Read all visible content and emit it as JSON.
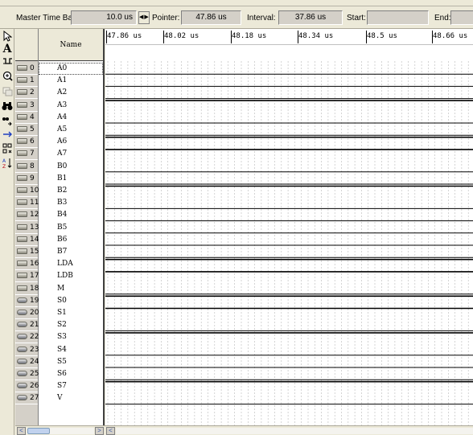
{
  "time_bar": {
    "master_label": "Master Time Bar:",
    "master_value": "10.0 us",
    "pointer_label": "Pointer:",
    "pointer_value": "47.86 us",
    "interval_label": "Interval:",
    "interval_value": "37.86 us",
    "start_label": "Start:",
    "start_value": "",
    "end_label": "End:",
    "end_value": ""
  },
  "toolbar": {
    "icons": [
      "selection-arrow-icon",
      "text-tool-icon",
      "waveform-editing-icon",
      "zoom-icon",
      "fullscreen-icon",
      "find-icon",
      "replace-icon",
      "assign-value-icon",
      "regroup-icon",
      "sort-icon"
    ]
  },
  "signal_table": {
    "name_header": "Name",
    "ruler_ticks": [
      "47.86 us",
      "48.02 us",
      "48.18 us",
      "48.34 us",
      "48.5 us",
      "48.66 us"
    ],
    "rows": [
      {
        "index": "0",
        "name": "A0",
        "kind": "input"
      },
      {
        "index": "1",
        "name": "A1",
        "kind": "input"
      },
      {
        "index": "2",
        "name": "A2",
        "kind": "input"
      },
      {
        "index": "3",
        "name": "A3",
        "kind": "input"
      },
      {
        "index": "4",
        "name": "A4",
        "kind": "input"
      },
      {
        "index": "5",
        "name": "A5",
        "kind": "input"
      },
      {
        "index": "6",
        "name": "A6",
        "kind": "input"
      },
      {
        "index": "7",
        "name": "A7",
        "kind": "input"
      },
      {
        "index": "8",
        "name": "B0",
        "kind": "input"
      },
      {
        "index": "9",
        "name": "B1",
        "kind": "input"
      },
      {
        "index": "10",
        "name": "B2",
        "kind": "input"
      },
      {
        "index": "11",
        "name": "B3",
        "kind": "input"
      },
      {
        "index": "12",
        "name": "B4",
        "kind": "input"
      },
      {
        "index": "13",
        "name": "B5",
        "kind": "input"
      },
      {
        "index": "14",
        "name": "B6",
        "kind": "input"
      },
      {
        "index": "15",
        "name": "B7",
        "kind": "input"
      },
      {
        "index": "16",
        "name": "LDA",
        "kind": "input"
      },
      {
        "index": "17",
        "name": "LDB",
        "kind": "input"
      },
      {
        "index": "18",
        "name": "M",
        "kind": "input"
      },
      {
        "index": "19",
        "name": "S0",
        "kind": "output"
      },
      {
        "index": "20",
        "name": "S1",
        "kind": "output"
      },
      {
        "index": "21",
        "name": "S2",
        "kind": "output"
      },
      {
        "index": "22",
        "name": "S3",
        "kind": "output"
      },
      {
        "index": "23",
        "name": "S4",
        "kind": "output"
      },
      {
        "index": "24",
        "name": "S5",
        "kind": "output"
      },
      {
        "index": "25",
        "name": "S6",
        "kind": "output"
      },
      {
        "index": "26",
        "name": "S7",
        "kind": "output"
      },
      {
        "index": "27",
        "name": "V",
        "kind": "output"
      }
    ],
    "waveform_levels": [
      "0",
      "0",
      "0",
      "1",
      "0",
      "0",
      "1",
      "1",
      "0",
      "0",
      "1",
      "0",
      "0",
      "0",
      "0",
      "0",
      "1",
      "1",
      "0",
      "1",
      "1",
      "0",
      "1",
      "0",
      "0",
      "0",
      "1",
      "0"
    ]
  }
}
